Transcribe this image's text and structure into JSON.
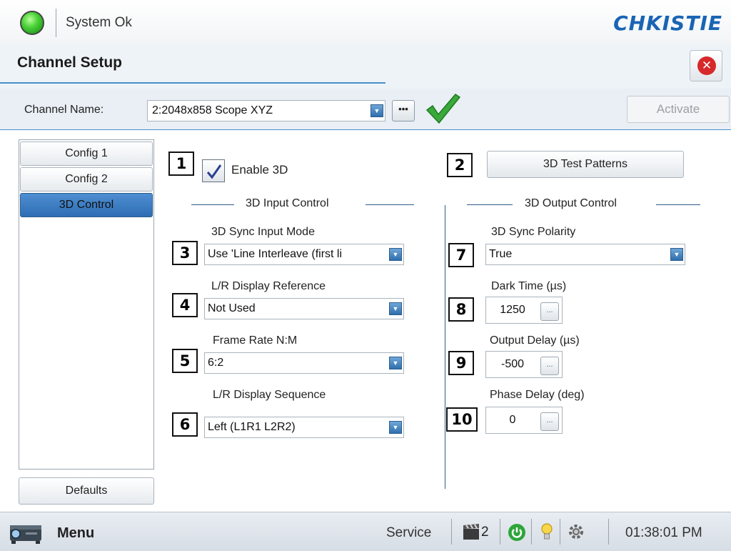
{
  "header": {
    "status_text": "System Ok",
    "logo_text": "CHKISTIE",
    "status_color": "#2fb52a",
    "accent_color": "#4a90c8"
  },
  "titlebar": {
    "title": "Channel Setup",
    "close_icon": "close-x"
  },
  "channel": {
    "label": "Channel Name:",
    "value": "2:2048x858 Scope XYZ",
    "dots_label": "•••",
    "activate_label": "Activate"
  },
  "sidebar": {
    "items": [
      {
        "label": "Config 1",
        "active": false
      },
      {
        "label": "Config 2",
        "active": false
      },
      {
        "label": "3D Control",
        "active": true
      }
    ],
    "defaults_label": "Defaults"
  },
  "annotations": [
    "1",
    "2",
    "3",
    "4",
    "5",
    "6",
    "7",
    "8",
    "9",
    "10"
  ],
  "enable3d": {
    "label": "Enable 3D",
    "checked": true
  },
  "test_patterns_label": "3D Test Patterns",
  "input_control": {
    "title": "3D Input Control",
    "sync_mode": {
      "label": "3D Sync Input Mode",
      "value": "Use 'Line Interleave (first li"
    },
    "lr_reference": {
      "label": "L/R Display Reference",
      "value": "Not Used"
    },
    "frame_rate": {
      "label": "Frame Rate N:M",
      "value": "6:2"
    },
    "lr_sequence": {
      "label": "L/R Display Sequence",
      "value": "Left (L1R1 L2R2)"
    }
  },
  "output_control": {
    "title": "3D Output Control",
    "sync_polarity": {
      "label": "3D Sync Polarity",
      "value": "True"
    },
    "dark_time": {
      "label": "Dark Time (µs)",
      "value": "1250"
    },
    "output_delay": {
      "label": "Output Delay (µs)",
      "value": "-500"
    },
    "phase_delay": {
      "label": "Phase Delay (deg)",
      "value": "0"
    },
    "edit_label": "..."
  },
  "footer": {
    "menu_label": "Menu",
    "service_label": "Service",
    "channel_number": "2",
    "time": "01:38:01 PM"
  }
}
